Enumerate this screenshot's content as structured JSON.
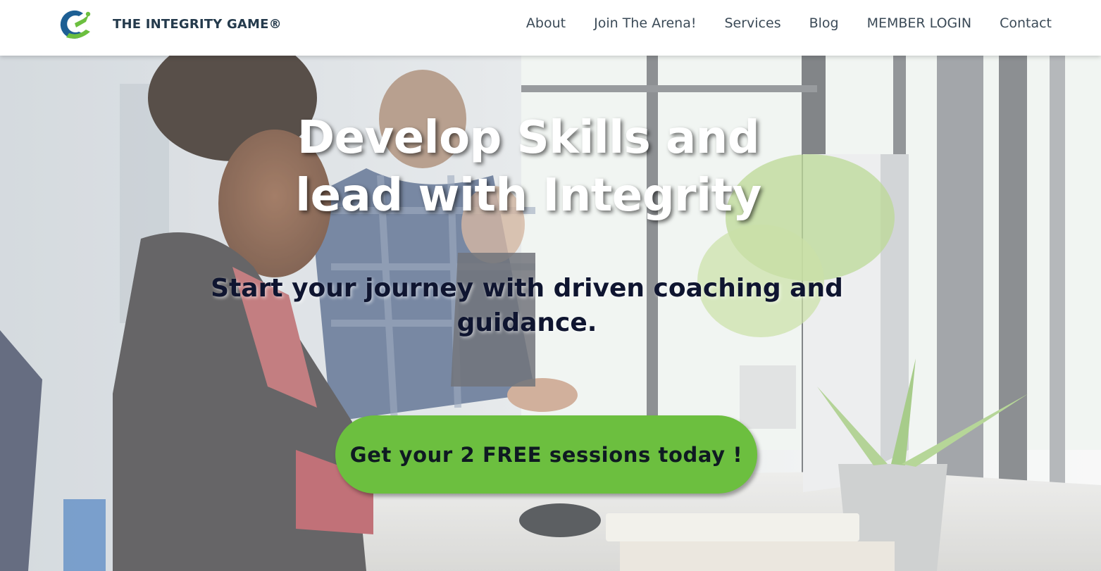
{
  "header": {
    "brand": "THE INTEGRITY GAME®",
    "logo_icon": "integrity-game-logo",
    "nav": [
      "About",
      "Join The Arena!",
      "Services",
      "Blog",
      "MEMBER LOGIN",
      "Contact"
    ]
  },
  "hero": {
    "headline_line1": "Develop Skills and",
    "headline_line2": "lead with Integrity",
    "subheadline": "Start your journey with driven coaching and guidance.",
    "cta_label": "Get your 2 FREE sessions today !",
    "background": "office-workers-at-computers-photo"
  },
  "colors": {
    "accent_green": "#6cbf3f",
    "brand_navy": "#243a4c",
    "logo_blue": "#1d5f94"
  }
}
